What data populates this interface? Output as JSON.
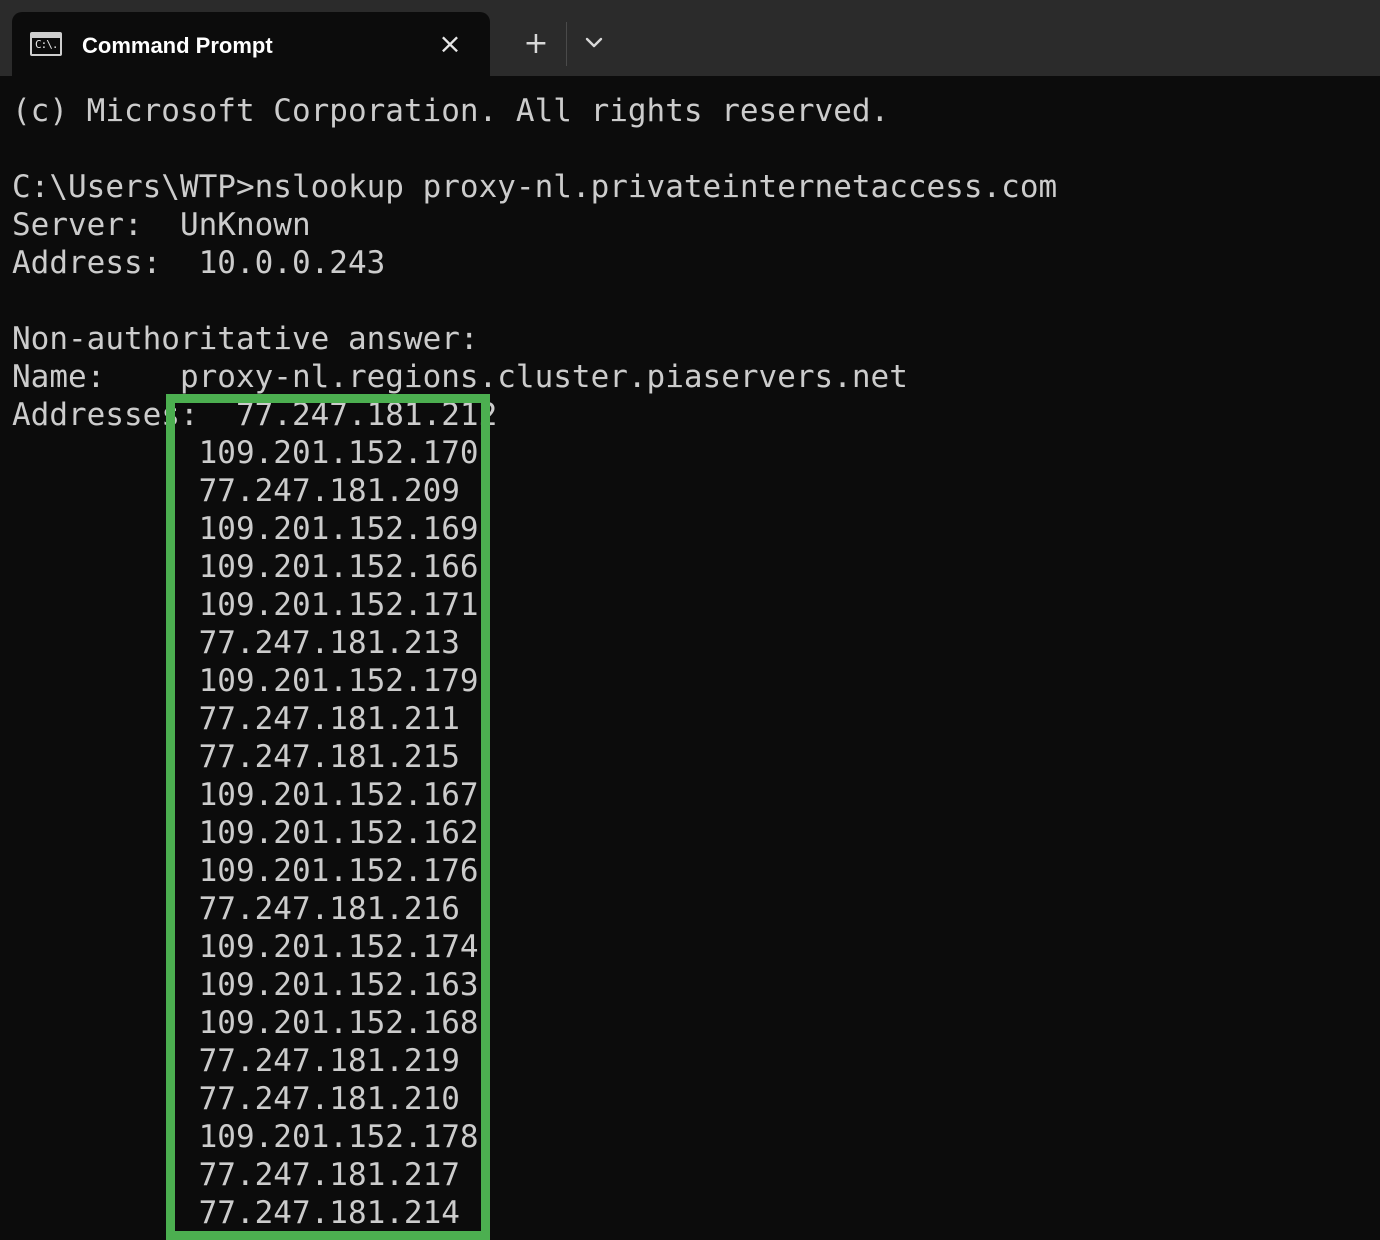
{
  "window": {
    "tab_title": "Command Prompt",
    "tab_icon_text": "C:\\."
  },
  "terminal": {
    "lines": [
      "(c) Microsoft Corporation. All rights reserved.",
      "",
      "C:\\Users\\WTP>nslookup proxy-nl.privateinternetaccess.com",
      "Server:  UnKnown",
      "Address:  10.0.0.243",
      "",
      "Non-authoritative answer:",
      "Name:    proxy-nl.regions.cluster.piaservers.net",
      "Addresses:  77.247.181.212",
      "          109.201.152.170",
      "          77.247.181.209",
      "          109.201.152.169",
      "          109.201.152.166",
      "          109.201.152.171",
      "          77.247.181.213",
      "          109.201.152.179",
      "          77.247.181.211",
      "          77.247.181.215",
      "          109.201.152.167",
      "          109.201.152.162",
      "          109.201.152.176",
      "          77.247.181.216",
      "          109.201.152.174",
      "          109.201.152.163",
      "          109.201.152.168",
      "          77.247.181.219",
      "          77.247.181.210",
      "          109.201.152.178",
      "          77.247.181.217",
      "          77.247.181.214"
    ]
  },
  "colors": {
    "highlight": "#4caf50",
    "terminal_bg": "#0c0c0c",
    "terminal_fg": "#cccccc",
    "tabbar_bg": "#2b2b2b"
  }
}
